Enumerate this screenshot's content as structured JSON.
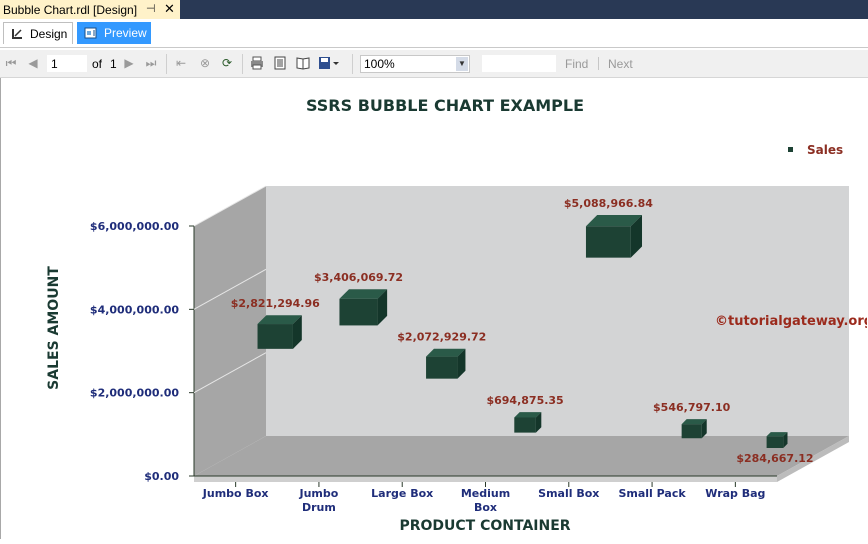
{
  "document_tab": {
    "title": "Bubble Chart.rdl [Design]",
    "pin_icon": "pin-icon",
    "close_icon": "close-icon"
  },
  "view_tabs": [
    {
      "label": "Design",
      "icon": "design-icon",
      "active": false
    },
    {
      "label": "Preview",
      "icon": "preview-icon",
      "active": true
    }
  ],
  "toolbar": {
    "page_current": "1",
    "of_label": "of",
    "page_total": "1",
    "zoom": "100%",
    "find_label": "Find",
    "next_label": "Next",
    "separator": "|"
  },
  "report": {
    "watermark": "©tutorialgateway.org"
  },
  "chart_data": {
    "type": "scatter",
    "title": "SSRS BUBBLE CHART EXAMPLE",
    "xlabel": "PRODUCT CONTAINER",
    "ylabel": "SALES AMOUNT",
    "legend": {
      "entries": [
        "Sales"
      ],
      "placement": "top-right"
    },
    "categories": [
      "Jumbo Box",
      "Jumbo Drum",
      "Large Box",
      "Medium Box",
      "Small Box",
      "Small Pack",
      "Wrap Bag"
    ],
    "series": [
      {
        "name": "Sales",
        "points": [
          {
            "category": "Jumbo Box",
            "value": 2821294.96,
            "label": "$2,821,294.96"
          },
          {
            "category": "Jumbo Drum",
            "value": 3406069.72,
            "label": "$3,406,069.72"
          },
          {
            "category": "Large Box",
            "value": 2072929.72,
            "label": "$2,072,929.72"
          },
          {
            "category": "Medium Box",
            "value": 694875.35,
            "label": "$694,875.35"
          },
          {
            "category": "Small Box",
            "value": 5088966.84,
            "label": "$5,088,966.84"
          },
          {
            "category": "Small Pack",
            "value": 546797.1,
            "label": "$546,797.10"
          },
          {
            "category": "Wrap Bag",
            "value": 284667.12,
            "label": "$284,667.12"
          }
        ]
      }
    ],
    "y_ticks": [
      "$0.00",
      "$2,000,000.00",
      "$4,000,000.00",
      "$6,000,000.00"
    ],
    "ylim": [
      0,
      6000000
    ],
    "grid": true,
    "colors": {
      "bubble": "#1d4234",
      "data_label": "#8b2e22",
      "axis_text": "#1f2d7a",
      "title": "#1a3a32",
      "back_wall": "#d3d4d5",
      "side_wall": "#a6a6a6",
      "floor": "#a6a6a6"
    }
  }
}
